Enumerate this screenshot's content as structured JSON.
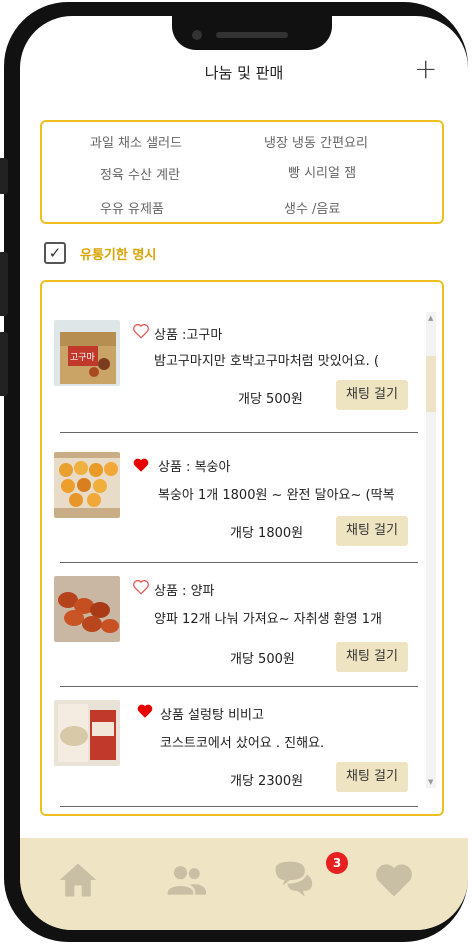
{
  "header": {
    "title": "나눔 및 판매",
    "add_label": "+"
  },
  "categories": [
    "과일 채소 샐러드",
    "냉장 냉동 간편요리",
    "정육 수산 계란",
    "빵 시리얼 잼",
    "우유 유제품",
    "생수 /음료"
  ],
  "filter": {
    "checked": true,
    "label": "유통기한 명시"
  },
  "chat_button_label": "채팅 걸기",
  "items": [
    {
      "name": "상품 :고구마",
      "desc": "밤고구마지만 호박고구마처럼 맛있어요. (",
      "price": "개당 500원",
      "liked": false,
      "icon": "sweet-potato-box-photo"
    },
    {
      "name": "상품 : 복숭아",
      "desc": "복숭아 1개 1800원 ~  완전 달아요~  (딱복",
      "price": "개당 1800원",
      "liked": true,
      "icon": "peach-box-photo"
    },
    {
      "name": "상품 : 양파",
      "desc": "양파 12개 나눠 가져요~ 자취생 환영 1개",
      "price": "개당 500원",
      "liked": false,
      "icon": "onion-photo"
    },
    {
      "name": "상품  설렁탕 비비고",
      "desc": "코스트코에서 샀어요 . 진해요.",
      "price": "개당 2300원",
      "liked": true,
      "icon": "soup-package-photo"
    }
  ],
  "tabbar": {
    "chat_badge": "3"
  },
  "colors": {
    "accent": "#f0c020",
    "tab_background": "#efe4c4",
    "heart": "#e60000",
    "badge": "#e82020"
  }
}
